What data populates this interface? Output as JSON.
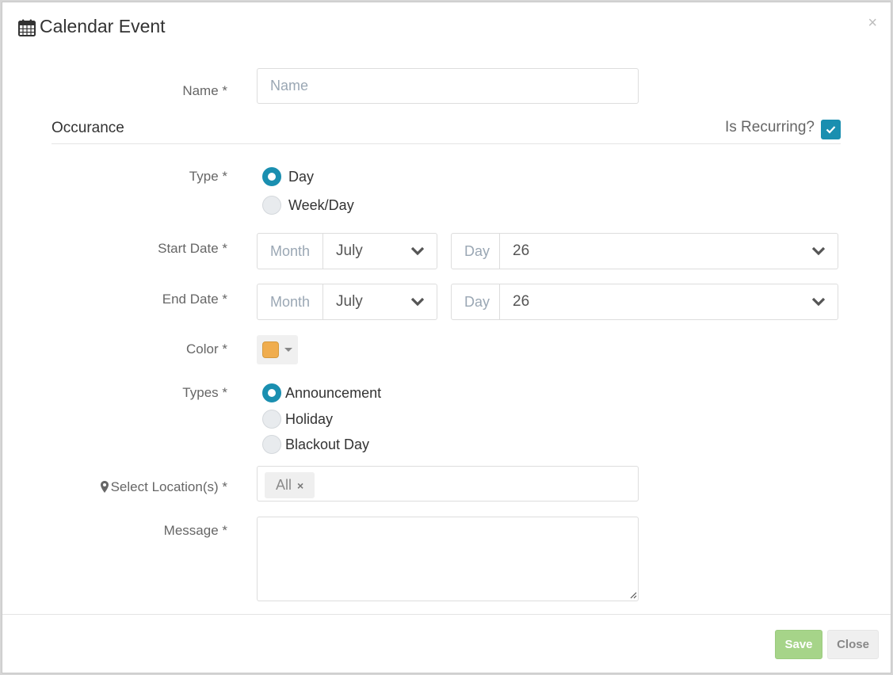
{
  "header": {
    "title": "Calendar Event",
    "close_glyph": "×",
    "icon": "calendar-icon"
  },
  "name_field": {
    "label": "Name *",
    "placeholder": "Name",
    "value": ""
  },
  "occurrence": {
    "section_title": "Occurance",
    "recurring_label": "Is Recurring?",
    "recurring_checked": true,
    "type_label": "Type *",
    "type_options": [
      {
        "label": "Day",
        "checked": true
      },
      {
        "label": "Week/Day",
        "checked": false
      }
    ],
    "start_date": {
      "label": "Start Date *",
      "month_prefix": "Month",
      "month_value": "July",
      "day_prefix": "Day",
      "day_value": "26"
    },
    "end_date": {
      "label": "End Date *",
      "month_prefix": "Month",
      "month_value": "July",
      "day_prefix": "Day",
      "day_value": "26"
    }
  },
  "color": {
    "label": "Color *",
    "value": "#f0ad4e"
  },
  "types": {
    "label": "Types *",
    "options": [
      {
        "label": "Announcement",
        "checked": true
      },
      {
        "label": "Holiday",
        "checked": false
      },
      {
        "label": "Blackout Day",
        "checked": false
      }
    ]
  },
  "location": {
    "label": "Select Location(s) *",
    "icon": "map-marker-icon",
    "tags": [
      {
        "label": "All",
        "remove_glyph": "×"
      }
    ]
  },
  "message": {
    "label": "Message *",
    "value": ""
  },
  "footer": {
    "save_label": "Save",
    "close_label": "Close"
  },
  "colors": {
    "accent": "#1a8fb0",
    "save_button": "#a6d489"
  }
}
